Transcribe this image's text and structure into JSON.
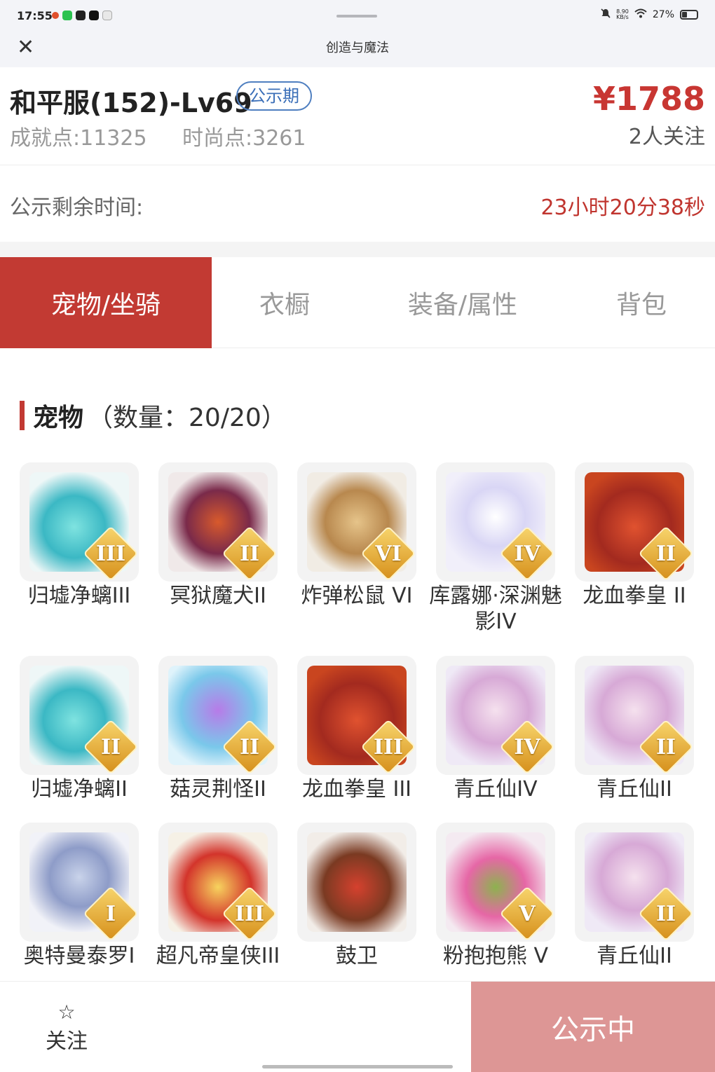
{
  "status_bar": {
    "time": "17:55",
    "speed_top": "8.90",
    "speed_unit": "KB/s",
    "battery": "27%"
  },
  "nav": {
    "title": "创造与魔法"
  },
  "account": {
    "title": "和平服(152)-Lv69",
    "badge": "公示期",
    "achievement": "成就点:11325",
    "fashion": "时尚点:3261",
    "price": "¥1788",
    "followers": "2人关注"
  },
  "timer": {
    "label": "公示剩余时间:",
    "value": "23小时20分38秒"
  },
  "tabs": [
    {
      "label": "宠物/坐骑",
      "active": true
    },
    {
      "label": "衣橱",
      "active": false
    },
    {
      "label": "装备/属性",
      "active": false
    },
    {
      "label": "背包",
      "active": false
    }
  ],
  "section": {
    "name": "宠物",
    "count": "（数量：20/20）"
  },
  "pets": [
    {
      "name": "归墟净螭III",
      "tier": "III",
      "art": "dragon-cyan"
    },
    {
      "name": "冥狱魔犬II",
      "tier": "II",
      "art": "hound-red"
    },
    {
      "name": "炸弹松鼠 VI",
      "tier": "VI",
      "art": "squirrel"
    },
    {
      "name": "库露娜·深渊魅影IV",
      "tier": "IV",
      "art": "ghost-girl"
    },
    {
      "name": "龙血拳皇 II",
      "tier": "II",
      "art": "bull-red"
    },
    {
      "name": "归墟净螭II",
      "tier": "II",
      "art": "dragon-cyan"
    },
    {
      "name": "菇灵荆怪II",
      "tier": "II",
      "art": "mushroom-purple"
    },
    {
      "name": "龙血拳皇 III",
      "tier": "III",
      "art": "bull-red"
    },
    {
      "name": "青丘仙IV",
      "tier": "IV",
      "art": "fox-fairy"
    },
    {
      "name": "青丘仙II",
      "tier": "II",
      "art": "fox-fairy"
    },
    {
      "name": "奥特曼泰罗I",
      "tier": "I",
      "art": "ultraman"
    },
    {
      "name": "超凡帝皇侠III",
      "tier": "III",
      "art": "gold-armor"
    },
    {
      "name": "鼓卫",
      "tier": "",
      "art": "drum-guard"
    },
    {
      "name": "粉抱抱熊 V",
      "tier": "V",
      "art": "pink-bear"
    },
    {
      "name": "青丘仙II",
      "tier": "II",
      "art": "fox-fairy"
    }
  ],
  "bottom": {
    "follow_label": "关注",
    "status_label": "公示中"
  },
  "colors": {
    "accent": "#c23a33",
    "price": "#c83632",
    "badge": "#3b6fb8",
    "status_button": "#dd9695"
  }
}
